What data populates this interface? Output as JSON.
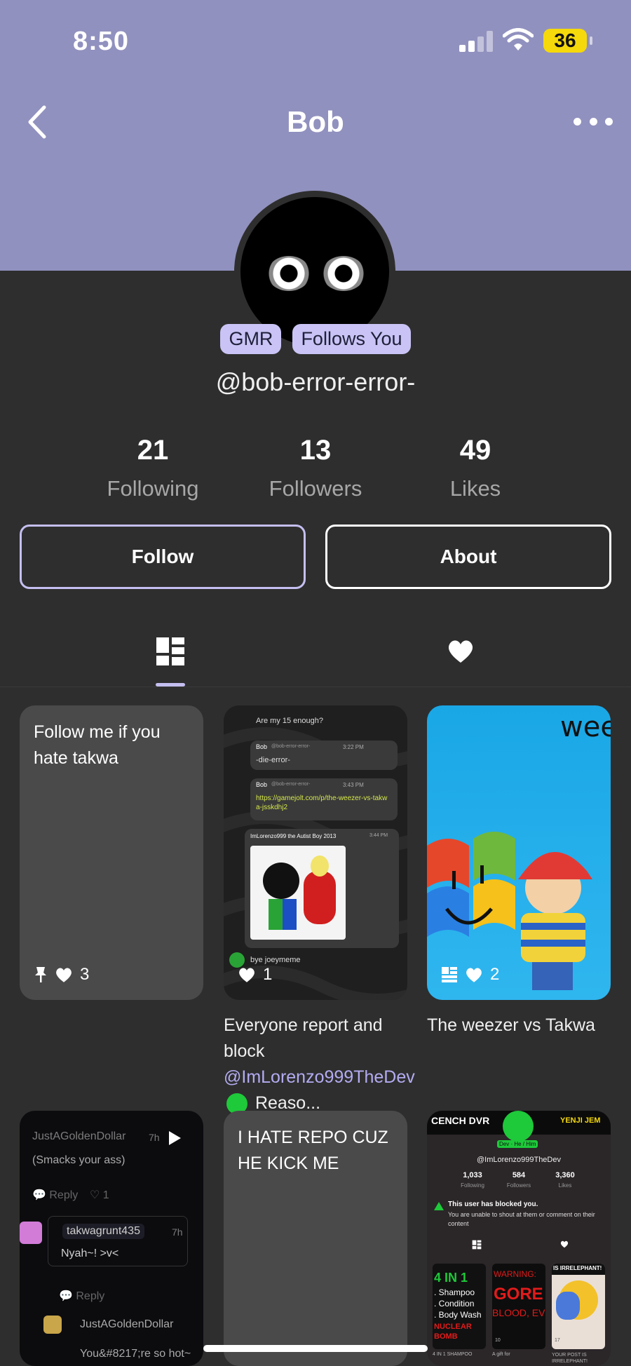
{
  "status_bar": {
    "time": "8:50",
    "battery": "36"
  },
  "header": {
    "title": "Bob"
  },
  "profile": {
    "badges": [
      "GMR",
      "Follows You"
    ],
    "handle": "@bob-error-error-",
    "stats": [
      {
        "value": "21",
        "label": "Following"
      },
      {
        "value": "13",
        "label": "Followers"
      },
      {
        "value": "49",
        "label": "Likes"
      }
    ],
    "follow_label": "Follow",
    "about_label": "About"
  },
  "colors": {
    "header_bg": "#9191bf",
    "accent": "#c4bff0",
    "page_bg": "#2e2e2e"
  },
  "posts": [
    {
      "text": "Follow me if you hate takwa",
      "likes": "3",
      "pinned": true
    },
    {
      "likes": "1",
      "caption_before": "Everyone report and block ",
      "caption_mention": "@ImLorenzo999TheDev",
      "caption_after": " Reaso...",
      "chat": {
        "line1": "Are my 15 enough?",
        "bob1_name": "Bob",
        "bob1_handle": "@bob-error-error-",
        "bob1_time": "3:22 PM",
        "bob1_msg": "-die-error-",
        "bob2_name": "Bob",
        "bob2_handle": "@bob-error-error-",
        "bob2_time": "3:43 PM",
        "bob2_link": "https://gamejolt.com/p/the-weezer-vs-takwa-jsskdhj2",
        "lorenzo_name": "ImLorenzo999 the Autist Boy 2013",
        "lorenzo_time": "3:44 PM",
        "bye": "bye joeymeme"
      }
    },
    {
      "likes": "2",
      "caption": "The weezer vs Takwa",
      "image_word": "wee"
    },
    {
      "chat": {
        "user1": "JustAGoldenDollar",
        "time1": "7h",
        "msg1": "(Smacks your ass)",
        "reply": "Reply",
        "likes1": "1",
        "user2": "takwagrunt435",
        "time2": "7h",
        "msg2": "Nyah~! >v<",
        "user3": "JustAGoldenDollar",
        "msg3": "You&#8217;re so hot~"
      }
    },
    {
      "text": "I HATE REPO CUZ HE KICK ME"
    },
    {
      "mini_profile": {
        "top_left": "CENCH DVR",
        "top_right": "YENJI JEM",
        "pronouns": "Dev · He / Him",
        "handle": "@ImLorenzo999TheDev",
        "stats": [
          {
            "value": "1,033",
            "label": "Following"
          },
          {
            "value": "584",
            "label": "Followers"
          },
          {
            "value": "3,360",
            "label": "Likes"
          }
        ],
        "blocked_title": "This user has blocked you.",
        "blocked_msg": "You are unable to shout at them or comment on their content",
        "thumb1_lines": [
          "4 IN 1",
          ". Shampoo",
          ". Condition",
          ". Body Wash",
          "NUCLEAR",
          "BOMB"
        ],
        "thumb1_caption": "4 IN 1 SHAMPOO",
        "thumb2_lines": [
          "WARNING:",
          "GORE",
          "BLOOD, EV"
        ],
        "thumb2_count": "10",
        "thumb2_caption": "A gift for",
        "thumb3_lines": [
          "IS IRRELEPHANT!"
        ],
        "thumb3_count": "17",
        "thumb3_caption": "YOUR POST IS IRRELEPHANT!"
      }
    }
  ]
}
